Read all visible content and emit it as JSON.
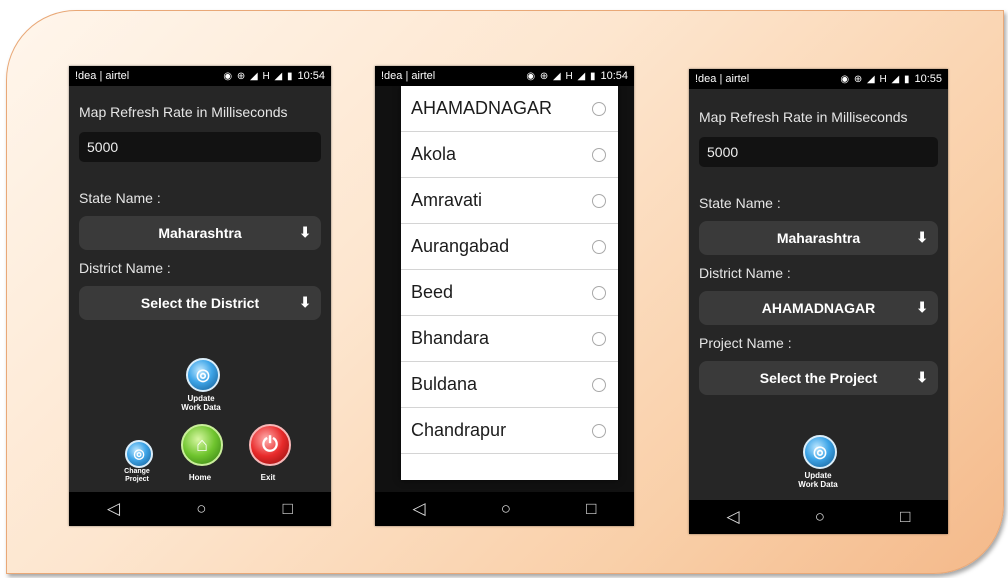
{
  "phone1": {
    "status": {
      "carrier": "!dea | airtel",
      "icons": "◉ ⊕ ◢ H ◢ ▮",
      "time": "10:54"
    },
    "refresh_label": "Map Refresh Rate in Milliseconds",
    "refresh_value": "5000",
    "state_label": "State Name :",
    "state_value": "Maharashtra",
    "district_label": "District Name :",
    "district_value": "Select the District",
    "update_label": "Update\nWork Data",
    "change_label": "Change\nProject",
    "home_label": "Home",
    "exit_label": "Exit"
  },
  "phone2": {
    "status": {
      "carrier": "!dea | airtel",
      "icons": "◉ ⊕ ◢ H ◢ ▮",
      "time": "10:54"
    },
    "districts": [
      "AHAMADNAGAR",
      "Akola",
      "Amravati",
      "Aurangabad",
      "Beed",
      "Bhandara",
      "Buldana",
      "Chandrapur"
    ]
  },
  "phone3": {
    "status": {
      "carrier": "!dea | airtel",
      "icons": "◉ ⊕ ◢ H ◢ ▮",
      "time": "10:55"
    },
    "refresh_label": "Map Refresh Rate in Milliseconds",
    "refresh_value": "5000",
    "state_label": "State Name :",
    "state_value": "Maharashtra",
    "district_label": "District Name :",
    "district_value": "AHAMADNAGAR",
    "project_label": "Project Name :",
    "project_value": "Select the Project",
    "update_label": "Update\nWork Data"
  },
  "nav": {
    "back": "◁",
    "home": "○",
    "recent": "□"
  },
  "colors": {
    "frame_start": "#fff6ec",
    "frame_end": "#f4b98a",
    "phone_bg": "#262626"
  }
}
